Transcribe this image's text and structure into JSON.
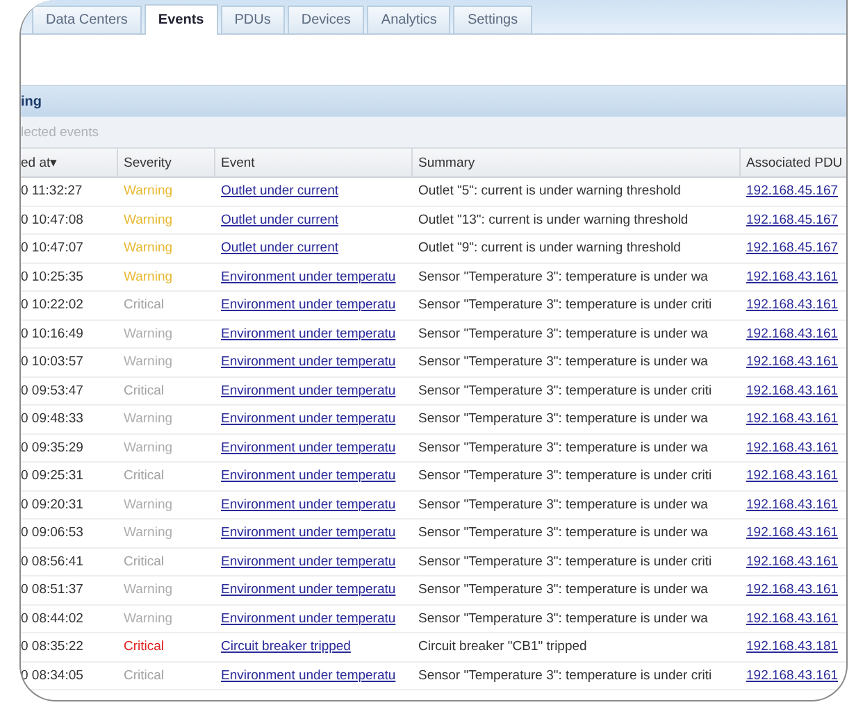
{
  "tabs": [
    {
      "label": "Data Centers",
      "selected": false
    },
    {
      "label": "Events",
      "selected": true
    },
    {
      "label": "PDUs",
      "selected": false
    },
    {
      "label": "Devices",
      "selected": false
    },
    {
      "label": "Analytics",
      "selected": false
    },
    {
      "label": "Settings",
      "selected": false
    }
  ],
  "panel_title": "ing",
  "toolbar_text": "lected events",
  "table": {
    "columns": [
      {
        "label": "ed at",
        "sort_icon": "▾"
      },
      {
        "label": "Severity"
      },
      {
        "label": "Event"
      },
      {
        "label": "Summary"
      },
      {
        "label": "Associated PDU"
      }
    ],
    "rows": [
      {
        "time": "0 11:32:27",
        "severity": "Warning",
        "kind": "warning",
        "active": true,
        "event": "Outlet under current",
        "summary": "Outlet \"5\": current is under warning threshold",
        "pdu": "192.168.45.167"
      },
      {
        "time": "0 10:47:08",
        "severity": "Warning",
        "kind": "warning",
        "active": true,
        "event": "Outlet under current",
        "summary": "Outlet \"13\": current is under warning threshold",
        "pdu": "192.168.45.167"
      },
      {
        "time": "0 10:47:07",
        "severity": "Warning",
        "kind": "warning",
        "active": true,
        "event": "Outlet under current",
        "summary": "Outlet \"9\": current is under warning threshold",
        "pdu": "192.168.45.167"
      },
      {
        "time": "0 10:25:35",
        "severity": "Warning",
        "kind": "warning",
        "active": true,
        "event": "Environment under temperatu",
        "summary": "Sensor \"Temperature 3\": temperature is under wa",
        "pdu": "192.168.43.161"
      },
      {
        "time": "0 10:22:02",
        "severity": "Critical",
        "kind": "critical",
        "active": false,
        "event": "Environment under temperatu",
        "summary": "Sensor \"Temperature 3\": temperature is under criti",
        "pdu": "192.168.43.161"
      },
      {
        "time": "0 10:16:49",
        "severity": "Warning",
        "kind": "warning",
        "active": false,
        "event": "Environment under temperatu",
        "summary": "Sensor \"Temperature 3\": temperature is under wa",
        "pdu": "192.168.43.161"
      },
      {
        "time": "0 10:03:57",
        "severity": "Warning",
        "kind": "warning",
        "active": false,
        "event": "Environment under temperatu",
        "summary": "Sensor \"Temperature 3\": temperature is under wa",
        "pdu": "192.168.43.161"
      },
      {
        "time": "0 09:53:47",
        "severity": "Critical",
        "kind": "critical",
        "active": false,
        "event": "Environment under temperatu",
        "summary": "Sensor \"Temperature 3\": temperature is under criti",
        "pdu": "192.168.43.161"
      },
      {
        "time": "0 09:48:33",
        "severity": "Warning",
        "kind": "warning",
        "active": false,
        "event": "Environment under temperatu",
        "summary": "Sensor \"Temperature 3\": temperature is under wa",
        "pdu": "192.168.43.161"
      },
      {
        "time": "0 09:35:29",
        "severity": "Warning",
        "kind": "warning",
        "active": false,
        "event": "Environment under temperatu",
        "summary": "Sensor \"Temperature 3\": temperature is under wa",
        "pdu": "192.168.43.161"
      },
      {
        "time": "0 09:25:31",
        "severity": "Critical",
        "kind": "critical",
        "active": false,
        "event": "Environment under temperatu",
        "summary": "Sensor \"Temperature 3\": temperature is under criti",
        "pdu": "192.168.43.161"
      },
      {
        "time": "0 09:20:31",
        "severity": "Warning",
        "kind": "warning",
        "active": false,
        "event": "Environment under temperatu",
        "summary": "Sensor \"Temperature 3\": temperature is under wa",
        "pdu": "192.168.43.161"
      },
      {
        "time": "0 09:06:53",
        "severity": "Warning",
        "kind": "warning",
        "active": false,
        "event": "Environment under temperatu",
        "summary": "Sensor \"Temperature 3\": temperature is under wa",
        "pdu": "192.168.43.161"
      },
      {
        "time": "0 08:56:41",
        "severity": "Critical",
        "kind": "critical",
        "active": false,
        "event": "Environment under temperatu",
        "summary": "Sensor \"Temperature 3\": temperature is under criti",
        "pdu": "192.168.43.161"
      },
      {
        "time": "0 08:51:37",
        "severity": "Warning",
        "kind": "warning",
        "active": false,
        "event": "Environment under temperatu",
        "summary": "Sensor \"Temperature 3\": temperature is under wa",
        "pdu": "192.168.43.161"
      },
      {
        "time": "0 08:44:02",
        "severity": "Warning",
        "kind": "warning",
        "active": false,
        "event": "Environment under temperatu",
        "summary": "Sensor \"Temperature 3\": temperature is under wa",
        "pdu": "192.168.43.161"
      },
      {
        "time": "0 08:35:22",
        "severity": "Critical",
        "kind": "critical",
        "active": true,
        "event": "Circuit breaker tripped",
        "summary": "Circuit breaker \"CB1\" tripped",
        "pdu": "192.168.43.181"
      },
      {
        "time": "0 08:34:05",
        "severity": "Critical",
        "kind": "critical",
        "active": false,
        "event": "Environment under temperatu",
        "summary": "Sensor \"Temperature 3\": temperature is under criti",
        "pdu": "192.168.43.161"
      }
    ]
  }
}
